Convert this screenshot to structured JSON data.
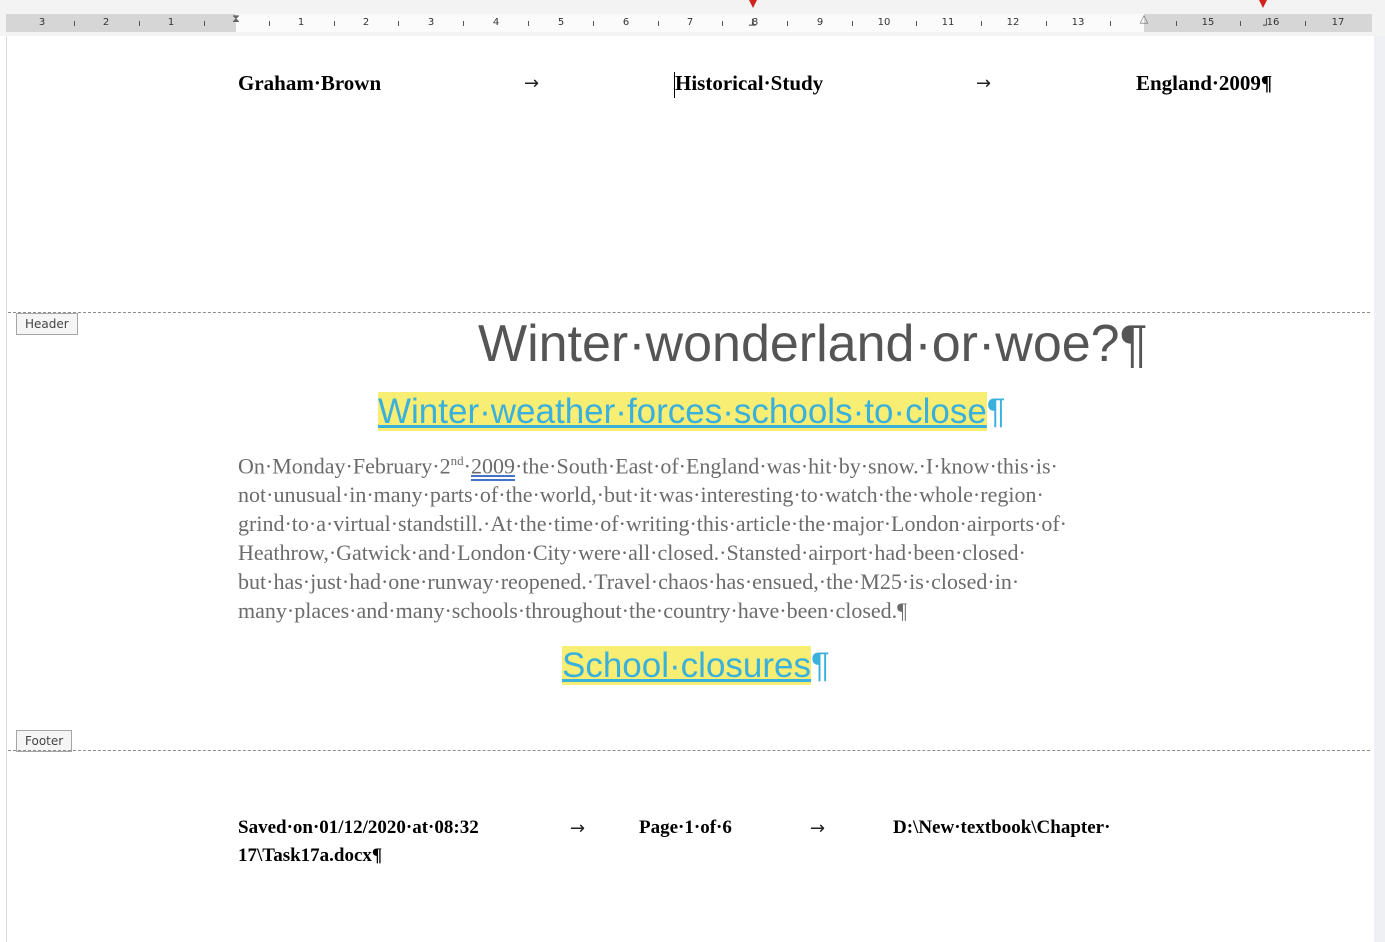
{
  "ruler": {
    "numbers_left": [
      "3",
      "2",
      "1"
    ],
    "numbers_right": [
      "1",
      "2",
      "3",
      "4",
      "5",
      "6",
      "7",
      "8",
      "9",
      "10",
      "11",
      "12",
      "13",
      "15",
      "16",
      "17"
    ]
  },
  "header": {
    "left": "Graham·Brown",
    "center": "Historical·Study",
    "right": "England·2009¶",
    "arrow_glyph": "→",
    "area_label": "Header"
  },
  "document": {
    "title": "Winter·wonderland·or·woe?¶",
    "subheading_1": "Winter·weather·forces·schools·to·close",
    "subheading_2": "School·closures",
    "pilcrow": "¶",
    "paragraph": {
      "line1_a": "On·Monday·February·2",
      "line1_sup": "nd",
      "line1_b": "·",
      "line1_year": "2009",
      "line1_c": "·the·South·East·of·England·was·hit·by·snow.·I·know·this·is·",
      "lines": [
        "not·unusual·in·many·parts·of·the·world,·but·it·was·interesting·to·watch·the·whole·region·",
        "grind·to·a·virtual·standstill.·At·the·time·of·writing·this·article·the·major·London·airports·of·",
        "Heathrow,·Gatwick·and·London·City·were·all·closed.·Stansted·airport·had·been·closed·",
        "but·has·just·had·one·runway·reopened.·Travel·chaos·has·ensued,·the·M25·is·closed·in·",
        "many·places·and·many·schools·throughout·the·country·have·been·closed.¶"
      ]
    }
  },
  "footer": {
    "area_label": "Footer",
    "saved": "Saved·on·01/12/2020·at·08:32",
    "page": "Page·1·of·6",
    "path_line1": "D:\\New·textbook\\Chapter·",
    "path_line2": "17\\Task17a.docx¶",
    "arrow_glyph": "→"
  },
  "colors": {
    "highlight": "#f7ee73",
    "subheading_text": "#3ab0dc",
    "title_text": "#555555",
    "body_text": "#6b6b6b",
    "ruler_marker": "#d0231b"
  }
}
